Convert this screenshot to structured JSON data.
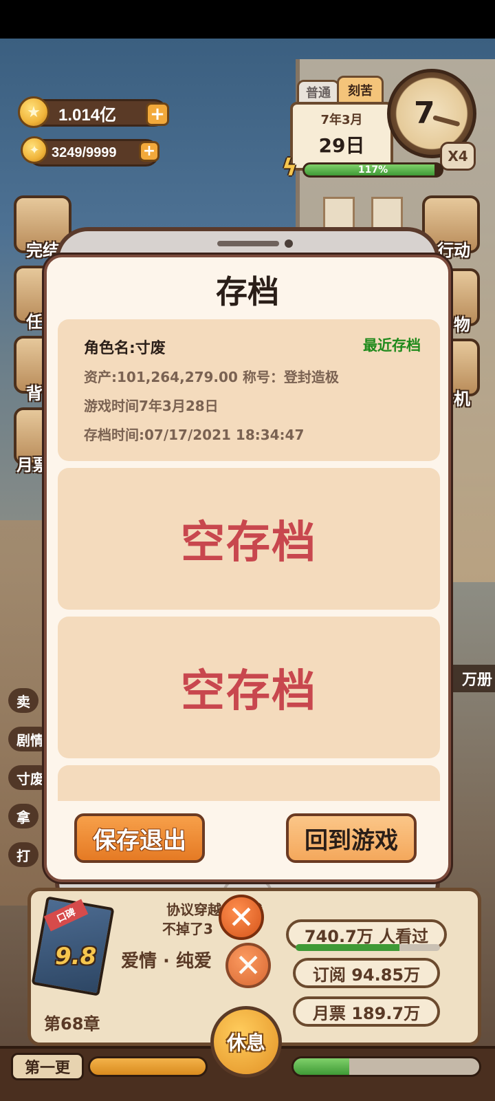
{
  "hud": {
    "coins": "1.014亿",
    "coin_icon": "star-coin-icon",
    "energy": "3249/9999",
    "energy_icon": "lightbulb-icon",
    "mode_tabs": [
      "普通",
      "刻苦"
    ],
    "calendar_month": "7年3月",
    "calendar_day": "29日",
    "clock_hour": "7",
    "speed": "X4",
    "energy_percent": "117%",
    "energy_fill_ratio": 0.95
  },
  "side_menu": {
    "left": [
      "完结",
      "任",
      "背",
      "月票"
    ],
    "right": [
      "行动",
      "物",
      "机"
    ],
    "right_badge": "万册"
  },
  "left_tags": [
    "卖",
    "剧情",
    "寸废",
    "拿",
    "打"
  ],
  "dialog": {
    "title": "存档",
    "slots": [
      {
        "name": "角色名:寸废",
        "recent": "最近存档",
        "assets_title": "资产:101,264,279.00  称号：登封造极",
        "game_time": "游戏时间7年3月28日",
        "save_time": "存档时间:07/17/2021  18:34:47"
      },
      {
        "empty_label": "空存档"
      },
      {
        "empty_label": "空存档"
      }
    ],
    "save_exit": "保存退出",
    "return_game": "回到游戏"
  },
  "book": {
    "badge": "口碑",
    "score": "9.8",
    "title_line1": "协议穿越之后我",
    "title_line2": "不掉了3",
    "genre": "爱情 · 纯爱",
    "chapter": "第68章",
    "views": "740.7万 人看过",
    "subscribe": "订阅  94.85万",
    "monthly": "月票  189.7万"
  },
  "bottom": {
    "update_chip": "第一更",
    "rest": "休息"
  },
  "colors": {
    "accent_orange": "#e57a24",
    "empty_red": "#c8474e",
    "recent_green": "#1f8a1c",
    "slot_bg": "#f4dbbd"
  }
}
